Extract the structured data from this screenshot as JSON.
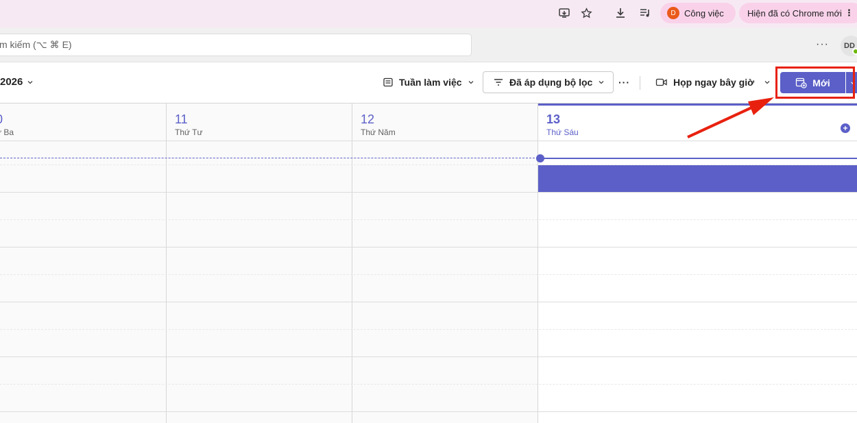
{
  "browser": {
    "profile_initial": "D",
    "profile_label": "Công việc",
    "update_label": "Hiện đã có Chrome mới",
    "menu_glyph": "⋮"
  },
  "search": {
    "text": "m kiếm (⌥ ⌘ E)"
  },
  "header": {
    "more_glyph": "···",
    "avatar_initials": "DD"
  },
  "toolbar": {
    "date_range": "2026",
    "view_label": "Tuần làm việc",
    "filter_label": "Đã áp dụng bộ lọc",
    "more_glyph": "···",
    "meet_now_label": "Họp ngay bây giờ",
    "new_label": "Mới"
  },
  "days": [
    {
      "number": "0",
      "name": "ứ Ba"
    },
    {
      "number": "11",
      "name": "Thứ Tư"
    },
    {
      "number": "12",
      "name": "Thứ Năm"
    },
    {
      "number": "13",
      "name": "Thứ Sáu",
      "today": true
    }
  ],
  "colors": {
    "accent": "#5b5fc7",
    "highlight": "#e8210f",
    "chrome_bar": "#f7e9f3"
  }
}
